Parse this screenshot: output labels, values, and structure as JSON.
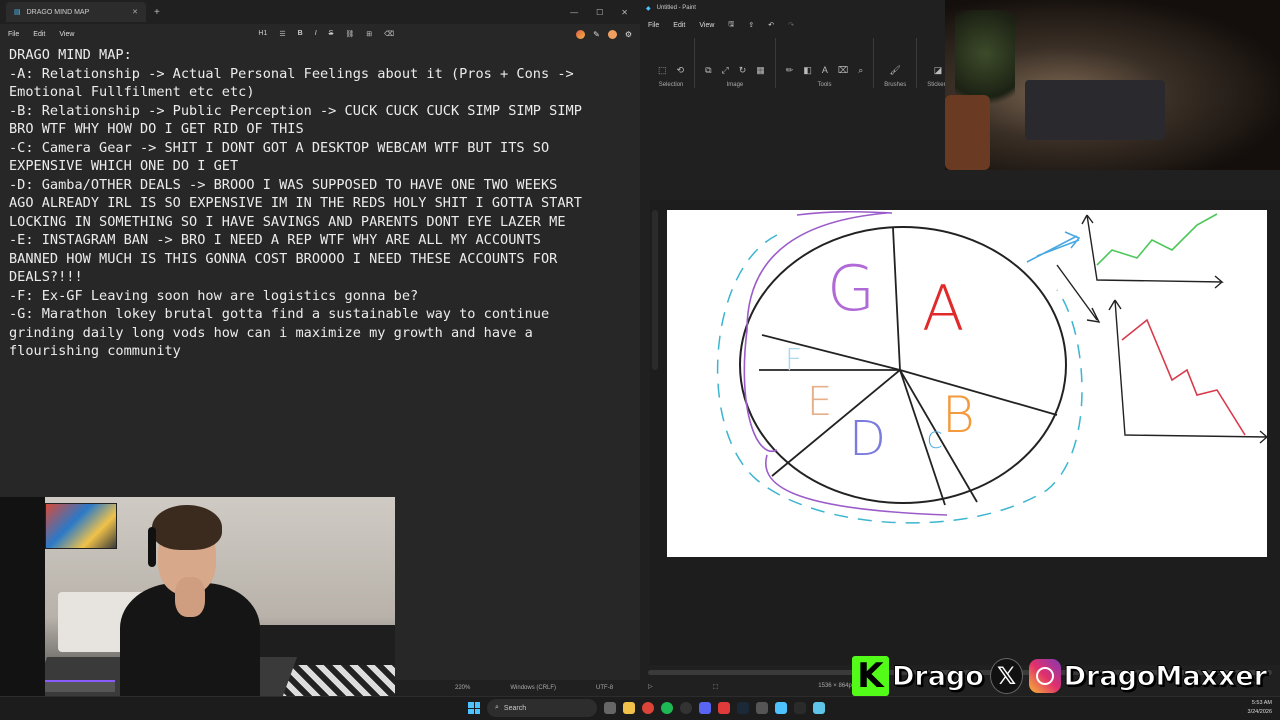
{
  "notepad": {
    "tab_title": "DRAGO MIND MAP",
    "menu": [
      "File",
      "Edit",
      "View"
    ],
    "heading_level": "H1",
    "lines": [
      "DRAGO MIND MAP:",
      "-A: Relationship -> Actual Personal Feelings about it (Pros + Cons ->",
      "Emotional Fullfilment etc etc)",
      "-B: Relationship -> Public Perception -> CUCK CUCK CUCK SIMP SIMP SIMP",
      "BRO WTF WHY HOW DO I GET RID OF THIS",
      "-C: Camera Gear -> SHIT I DONT GOT A DESKTOP WEBCAM WTF BUT ITS SO",
      "EXPENSIVE WHICH ONE DO I GET",
      "-D: Gamba/OTHER DEALS -> BROOO I WAS SUPPOSED TO HAVE ONE TWO WEEKS",
      "AGO ALREADY IRL IS SO EXPENSIVE IM IN THE REDS HOLY SHIT I GOTTA START",
      "LOCKING IN SOMETHING SO I HAVE SAVINGS AND PARENTS DONT EYE LAZER ME",
      "-E: INSTAGRAM BAN -> BRO I NEED A REP WTF WHY ARE ALL MY ACCOUNTS",
      "BANNED HOW MUCH IS THIS GONNA COST BROOOO I NEED THESE ACCOUNTS FOR",
      "DEALS?!!!",
      "-F: Ex-GF Leaving soon how are logistics gonna be?",
      "-G: Marathon lokey brutal gotta find a sustainable way to continue",
      "grinding daily long vods how can i maximize my growth and have a",
      "flourishing community"
    ],
    "status": {
      "zoom": "220%",
      "line_ending": "Windows (CRLF)",
      "encoding": "UTF-8"
    }
  },
  "paint": {
    "title": "Untitled - Paint",
    "menu": [
      "File",
      "Edit",
      "View"
    ],
    "ribbon_groups": [
      "Selection",
      "Image",
      "Tools",
      "Brushes",
      "Stickers"
    ],
    "canvas_size": "1536 × 864px",
    "pie_letters": [
      {
        "letter": "G",
        "color": "#b06ad8"
      },
      {
        "letter": "A",
        "color": "#e02a2a"
      },
      {
        "letter": "B",
        "color": "#f29a3c"
      },
      {
        "letter": "C",
        "color": "#4aa8e0"
      },
      {
        "letter": "D",
        "color": "#7a7adf"
      },
      {
        "letter": "E",
        "color": "#e7b08a"
      },
      {
        "letter": "F",
        "color": "#a9d8ef"
      }
    ]
  },
  "overlay": {
    "kick_name": "Drago",
    "ig_name": "DragoMaxxer",
    "kick_color": "#53fc18"
  },
  "taskbar": {
    "search_label": "Search",
    "time": "5:53 AM",
    "date": "3/24/2026"
  }
}
